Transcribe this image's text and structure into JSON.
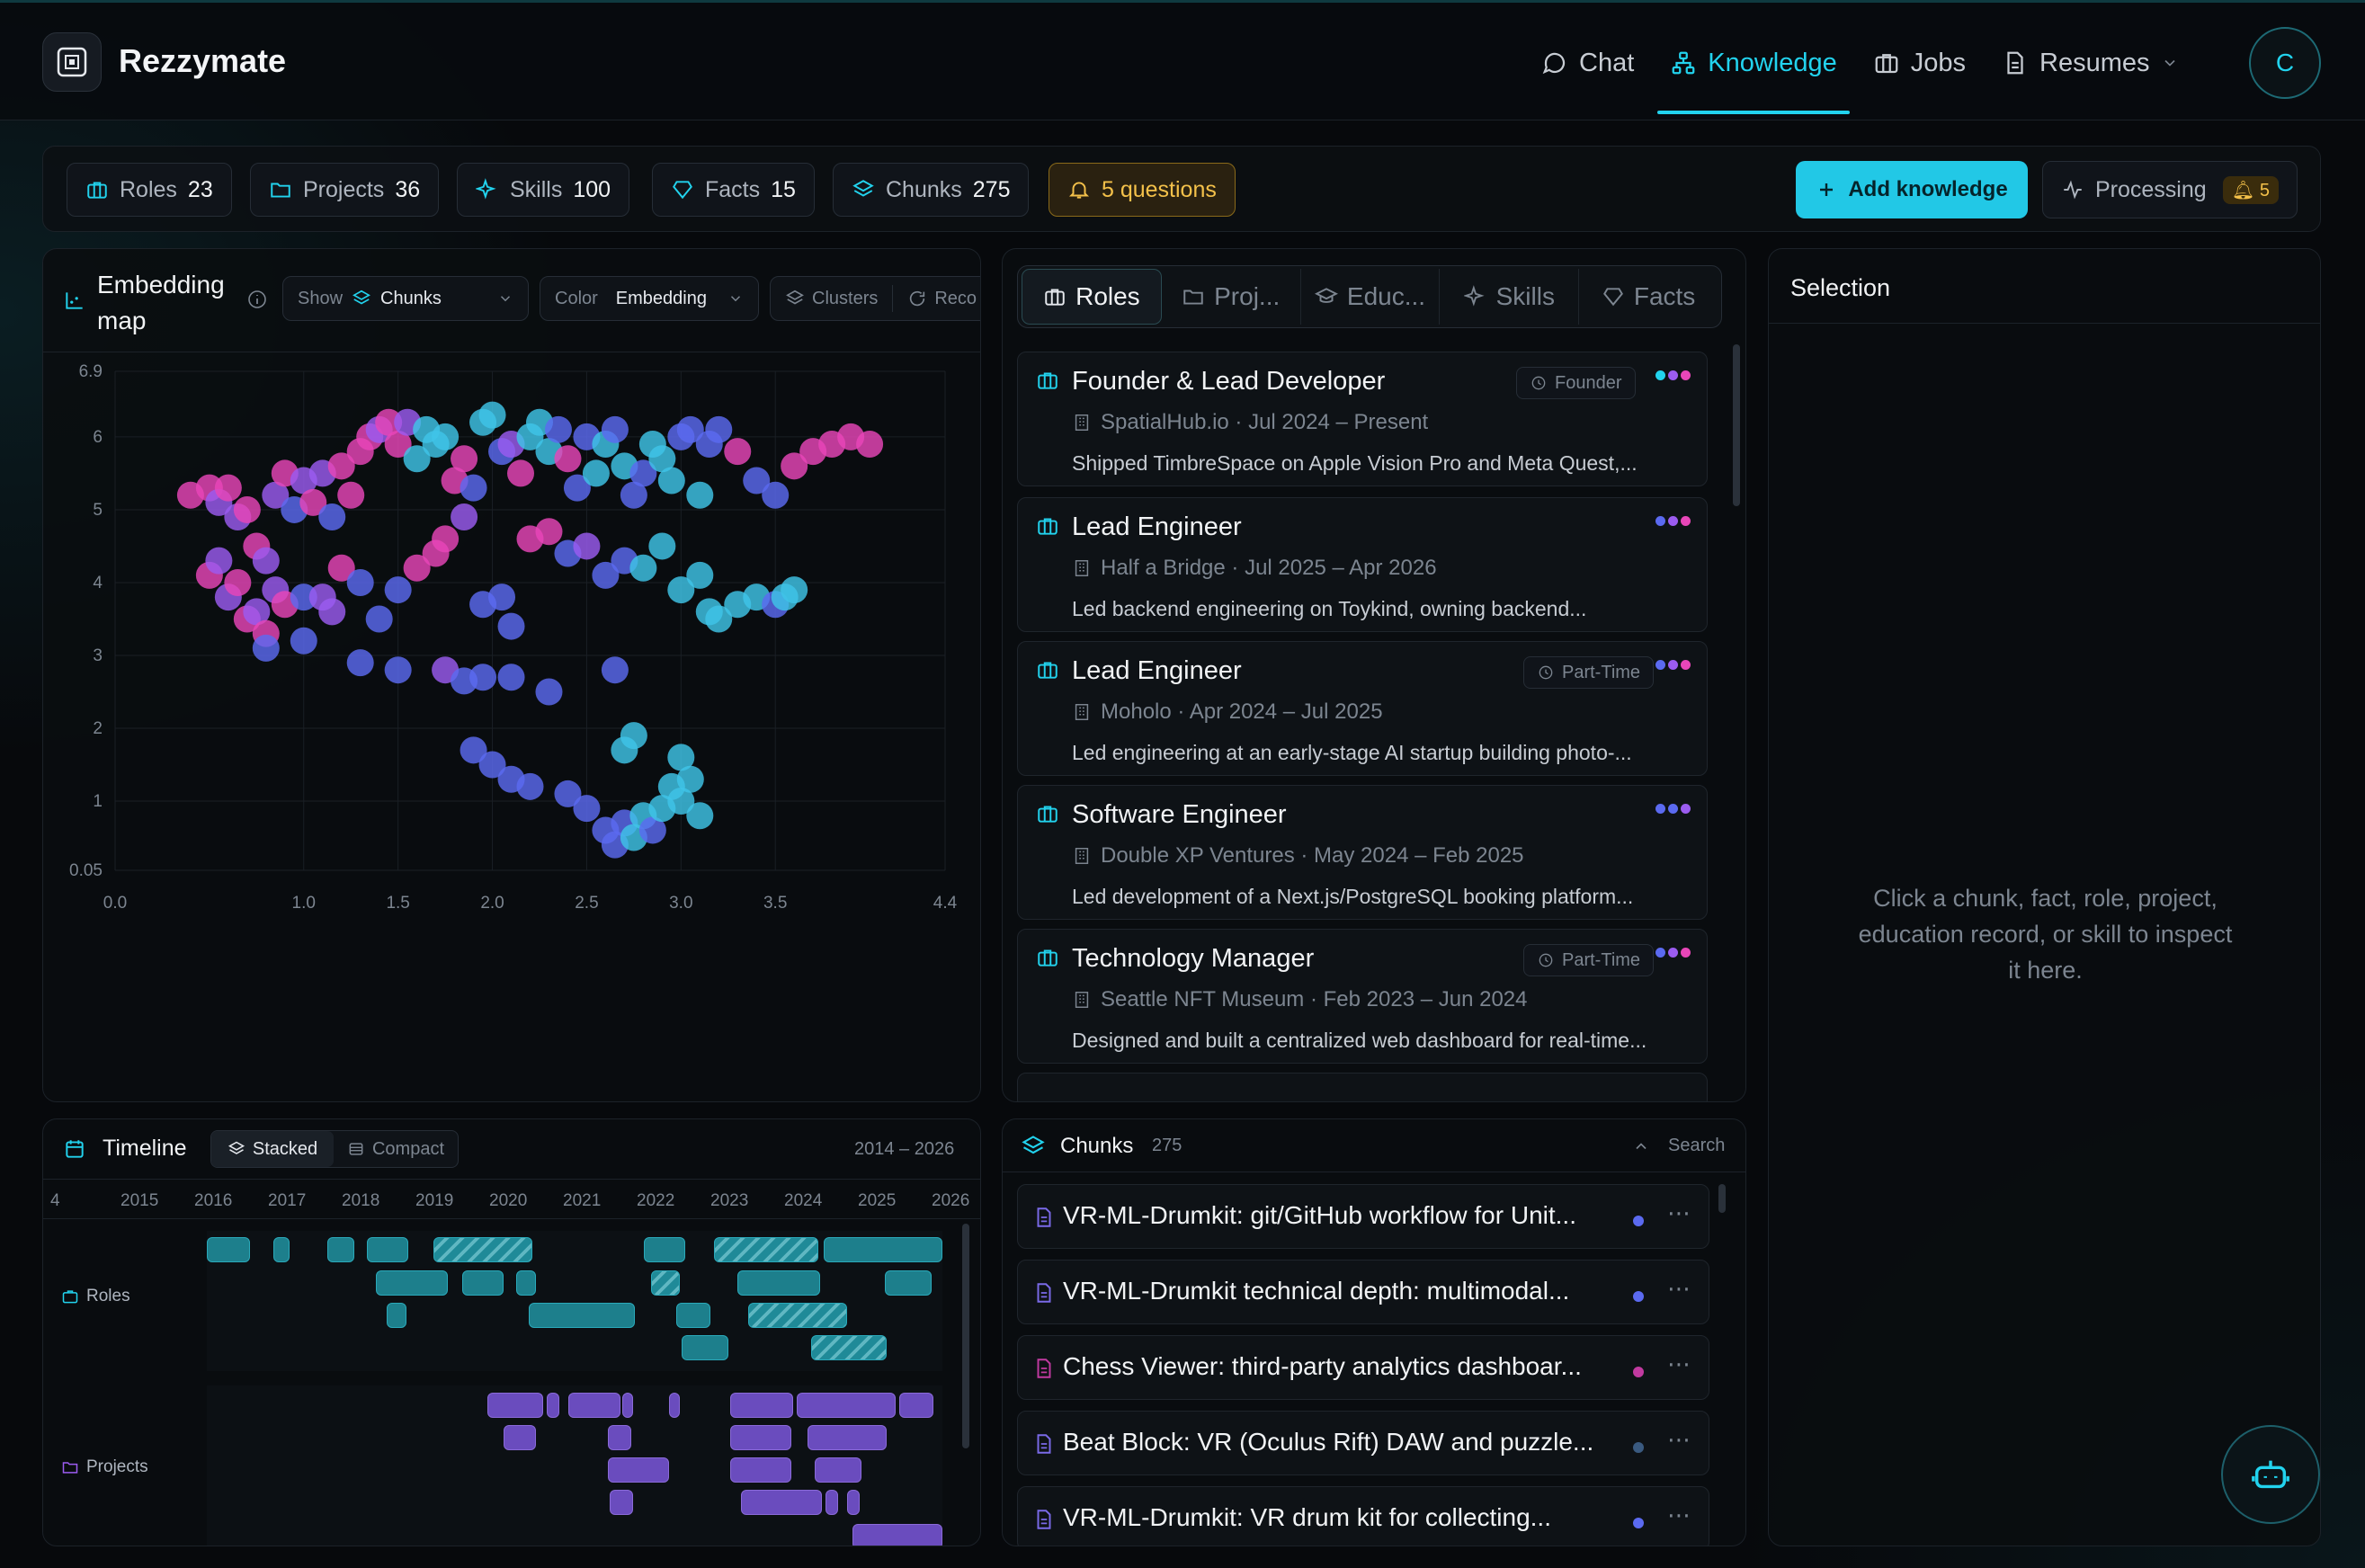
{
  "app": {
    "brand": "Rezzymate",
    "avatar_initial": "C"
  },
  "nav": [
    {
      "label": "Chat",
      "icon": "chat-icon",
      "active": false
    },
    {
      "label": "Knowledge",
      "icon": "knowledge-graph-icon",
      "active": true
    },
    {
      "label": "Jobs",
      "icon": "briefcase-icon",
      "active": false
    },
    {
      "label": "Resumes",
      "icon": "document-icon",
      "active": false
    }
  ],
  "stats": [
    {
      "label": "Roles",
      "count": "23",
      "icon": "briefcase-icon"
    },
    {
      "label": "Projects",
      "count": "36",
      "icon": "folder-icon"
    },
    {
      "label": "Skills",
      "count": "100",
      "icon": "sparkle-icon"
    },
    {
      "label": "Facts",
      "count": "15",
      "icon": "gem-icon"
    },
    {
      "label": "Chunks",
      "count": "275",
      "icon": "layers-icon"
    }
  ],
  "questions": "5 questions",
  "add_knowledge": "Add knowledge",
  "processing": {
    "label": "Processing",
    "count": "5"
  },
  "embedding": {
    "title_line1": "Embedding",
    "title_line2": "map",
    "show_label": "Show",
    "show_value": "Chunks",
    "color_label": "Color",
    "color_value": "Embedding",
    "clusters": "Clusters",
    "recompute": "Reco"
  },
  "chart_data": {
    "type": "scatter",
    "title": "",
    "xlabel": "",
    "ylabel": "",
    "xlim": [
      0.0,
      4.4
    ],
    "ylim": [
      0.05,
      6.9
    ],
    "x_ticks": [
      "0.0",
      "1.0",
      "1.5",
      "2.0",
      "2.5",
      "3.0",
      "3.5",
      "4.4"
    ],
    "y_ticks": [
      "6.9",
      "6",
      "5",
      "4",
      "3",
      "2",
      "1",
      "0.05"
    ],
    "grid": true,
    "legend": "none",
    "colors": {
      "pink": "#e846b8",
      "violet": "#9b5cf0",
      "blue": "#5b6af0",
      "cyan": "#3fc4e8"
    },
    "points": [
      [
        0.4,
        5.2,
        "pink"
      ],
      [
        0.5,
        5.3,
        "pink"
      ],
      [
        0.55,
        5.1,
        "violet"
      ],
      [
        0.6,
        5.3,
        "pink"
      ],
      [
        0.65,
        4.9,
        "violet"
      ],
      [
        0.7,
        5.0,
        "pink"
      ],
      [
        0.75,
        4.5,
        "pink"
      ],
      [
        0.8,
        4.3,
        "violet"
      ],
      [
        0.85,
        5.2,
        "violet"
      ],
      [
        0.9,
        5.5,
        "pink"
      ],
      [
        0.95,
        5.0,
        "blue"
      ],
      [
        1.0,
        5.4,
        "violet"
      ],
      [
        1.05,
        5.1,
        "pink"
      ],
      [
        1.1,
        5.5,
        "violet"
      ],
      [
        1.15,
        4.9,
        "blue"
      ],
      [
        1.2,
        5.6,
        "pink"
      ],
      [
        1.25,
        5.2,
        "pink"
      ],
      [
        1.3,
        5.8,
        "pink"
      ],
      [
        1.35,
        6.0,
        "pink"
      ],
      [
        1.4,
        6.1,
        "violet"
      ],
      [
        1.45,
        6.2,
        "pink"
      ],
      [
        1.5,
        5.9,
        "pink"
      ],
      [
        1.55,
        6.2,
        "violet"
      ],
      [
        1.6,
        5.7,
        "cyan"
      ],
      [
        1.65,
        6.1,
        "cyan"
      ],
      [
        1.7,
        5.9,
        "cyan"
      ],
      [
        1.75,
        6.0,
        "cyan"
      ],
      [
        1.8,
        5.4,
        "pink"
      ],
      [
        1.85,
        5.7,
        "pink"
      ],
      [
        1.9,
        5.3,
        "blue"
      ],
      [
        1.95,
        6.2,
        "cyan"
      ],
      [
        2.0,
        6.3,
        "cyan"
      ],
      [
        2.05,
        5.8,
        "blue"
      ],
      [
        2.1,
        5.9,
        "violet"
      ],
      [
        2.15,
        5.5,
        "pink"
      ],
      [
        2.2,
        6.0,
        "cyan"
      ],
      [
        2.25,
        6.2,
        "cyan"
      ],
      [
        2.3,
        5.8,
        "cyan"
      ],
      [
        2.35,
        6.1,
        "blue"
      ],
      [
        2.4,
        5.7,
        "pink"
      ],
      [
        2.45,
        5.3,
        "blue"
      ],
      [
        2.5,
        6.0,
        "blue"
      ],
      [
        2.55,
        5.5,
        "cyan"
      ],
      [
        2.6,
        5.9,
        "cyan"
      ],
      [
        2.65,
        6.1,
        "blue"
      ],
      [
        2.7,
        5.6,
        "cyan"
      ],
      [
        2.75,
        5.2,
        "blue"
      ],
      [
        2.8,
        5.5,
        "blue"
      ],
      [
        2.85,
        5.9,
        "cyan"
      ],
      [
        2.9,
        5.7,
        "cyan"
      ],
      [
        2.95,
        5.4,
        "cyan"
      ],
      [
        3.0,
        6.0,
        "blue"
      ],
      [
        3.05,
        6.1,
        "blue"
      ],
      [
        3.1,
        5.2,
        "cyan"
      ],
      [
        3.15,
        5.9,
        "blue"
      ],
      [
        3.2,
        6.1,
        "blue"
      ],
      [
        3.3,
        5.8,
        "pink"
      ],
      [
        3.4,
        5.4,
        "blue"
      ],
      [
        3.5,
        5.2,
        "blue"
      ],
      [
        3.6,
        5.6,
        "pink"
      ],
      [
        3.7,
        5.8,
        "pink"
      ],
      [
        3.8,
        5.9,
        "pink"
      ],
      [
        3.9,
        6.0,
        "pink"
      ],
      [
        4.0,
        5.9,
        "pink"
      ],
      [
        0.5,
        4.1,
        "pink"
      ],
      [
        0.55,
        4.3,
        "violet"
      ],
      [
        0.6,
        3.8,
        "violet"
      ],
      [
        0.65,
        4.0,
        "pink"
      ],
      [
        0.7,
        3.5,
        "pink"
      ],
      [
        0.75,
        3.6,
        "violet"
      ],
      [
        0.8,
        3.3,
        "pink"
      ],
      [
        0.85,
        3.9,
        "violet"
      ],
      [
        0.9,
        3.7,
        "pink"
      ],
      [
        1.0,
        3.8,
        "blue"
      ],
      [
        1.1,
        3.8,
        "violet"
      ],
      [
        1.15,
        3.6,
        "violet"
      ],
      [
        1.2,
        4.2,
        "pink"
      ],
      [
        1.3,
        4.0,
        "blue"
      ],
      [
        1.4,
        3.5,
        "blue"
      ],
      [
        1.5,
        3.9,
        "blue"
      ],
      [
        1.6,
        4.2,
        "pink"
      ],
      [
        1.7,
        4.4,
        "pink"
      ],
      [
        1.75,
        4.6,
        "pink"
      ],
      [
        1.85,
        4.9,
        "violet"
      ],
      [
        1.95,
        3.7,
        "blue"
      ],
      [
        2.05,
        3.8,
        "blue"
      ],
      [
        2.1,
        3.4,
        "blue"
      ],
      [
        2.2,
        4.6,
        "pink"
      ],
      [
        2.3,
        4.7,
        "pink"
      ],
      [
        2.4,
        4.4,
        "blue"
      ],
      [
        2.5,
        4.5,
        "violet"
      ],
      [
        2.6,
        4.1,
        "blue"
      ],
      [
        2.7,
        4.3,
        "blue"
      ],
      [
        2.8,
        4.2,
        "cyan"
      ],
      [
        2.9,
        4.5,
        "cyan"
      ],
      [
        3.0,
        3.9,
        "cyan"
      ],
      [
        3.1,
        4.1,
        "cyan"
      ],
      [
        3.15,
        3.6,
        "cyan"
      ],
      [
        3.2,
        3.5,
        "cyan"
      ],
      [
        3.3,
        3.7,
        "cyan"
      ],
      [
        3.4,
        3.8,
        "cyan"
      ],
      [
        3.5,
        3.7,
        "blue"
      ],
      [
        3.55,
        3.8,
        "cyan"
      ],
      [
        3.6,
        3.9,
        "cyan"
      ],
      [
        0.8,
        3.1,
        "blue"
      ],
      [
        1.0,
        3.2,
        "blue"
      ],
      [
        1.3,
        2.9,
        "blue"
      ],
      [
        1.5,
        2.8,
        "blue"
      ],
      [
        1.75,
        2.8,
        "violet"
      ],
      [
        1.85,
        2.65,
        "blue"
      ],
      [
        1.95,
        2.7,
        "blue"
      ],
      [
        2.1,
        2.7,
        "blue"
      ],
      [
        2.3,
        2.5,
        "blue"
      ],
      [
        2.65,
        2.8,
        "blue"
      ],
      [
        1.9,
        1.7,
        "blue"
      ],
      [
        2.0,
        1.5,
        "blue"
      ],
      [
        2.1,
        1.3,
        "blue"
      ],
      [
        2.2,
        1.2,
        "blue"
      ],
      [
        2.4,
        1.1,
        "blue"
      ],
      [
        2.5,
        0.9,
        "blue"
      ],
      [
        2.6,
        0.6,
        "blue"
      ],
      [
        2.65,
        0.4,
        "blue"
      ],
      [
        2.7,
        0.7,
        "blue"
      ],
      [
        2.75,
        0.5,
        "cyan"
      ],
      [
        2.8,
        0.8,
        "cyan"
      ],
      [
        2.85,
        0.6,
        "blue"
      ],
      [
        2.9,
        0.9,
        "cyan"
      ],
      [
        2.95,
        1.2,
        "cyan"
      ],
      [
        3.0,
        1.0,
        "cyan"
      ],
      [
        3.05,
        1.3,
        "cyan"
      ],
      [
        3.1,
        0.8,
        "cyan"
      ],
      [
        3.0,
        1.6,
        "cyan"
      ],
      [
        2.75,
        1.9,
        "cyan"
      ],
      [
        2.7,
        1.7,
        "cyan"
      ]
    ]
  },
  "timeline": {
    "title": "Timeline",
    "stacked": "Stacked",
    "compact": "Compact",
    "range": "2014 – 2026",
    "years": [
      "4",
      "2015",
      "2016",
      "2017",
      "2018",
      "2019",
      "2020",
      "2021",
      "2022",
      "2023",
      "2024",
      "2025",
      "2026"
    ],
    "row_roles": "Roles",
    "row_projects": "Projects"
  },
  "tabs": [
    {
      "label": "Roles",
      "icon": "briefcase-icon",
      "active": true
    },
    {
      "label": "Proj...",
      "icon": "folder-icon",
      "active": false
    },
    {
      "label": "Educ...",
      "icon": "graduation-cap-icon",
      "active": false
    },
    {
      "label": "Skills",
      "icon": "sparkle-icon",
      "active": false
    },
    {
      "label": "Facts",
      "icon": "gem-icon",
      "active": false
    }
  ],
  "roles": [
    {
      "title": "Founder & Lead Developer",
      "org": "SpatialHub.io · Jul 2024 – Present",
      "desc": "Shipped TimbreSpace on Apple Vision Pro and Meta Quest,...",
      "pill": "Founder",
      "pill_icon": "rocket-icon",
      "dots": [
        "#22d3ee",
        "#9b5cf0",
        "#e846b8"
      ]
    },
    {
      "title": "Lead Engineer",
      "org": "Half a Bridge · Jul 2025 – Apr 2026",
      "desc": "Led backend engineering on Toykind, owning backend...",
      "pill": "",
      "pill_icon": "",
      "dots": [
        "#5b6af0",
        "#9b5cf0",
        "#e846b8"
      ]
    },
    {
      "title": "Lead Engineer",
      "org": "Moholo · Apr 2024 – Jul 2025",
      "desc": "Led engineering at an early-stage AI startup building photo-...",
      "pill": "Part-Time",
      "pill_icon": "clock-icon",
      "dots": [
        "#5b6af0",
        "#9b5cf0",
        "#e846b8"
      ]
    },
    {
      "title": "Software Engineer",
      "org": "Double XP Ventures · May 2024 – Feb 2025",
      "desc": "Led development of a Next.js/PostgreSQL booking platform...",
      "pill": "",
      "pill_icon": "",
      "dots": [
        "#5b6af0",
        "#5b6af0",
        "#9b5cf0"
      ]
    },
    {
      "title": "Technology Manager",
      "org": "Seattle NFT Museum · Feb 2023 – Jun 2024",
      "desc": "Designed and built a centralized web dashboard for real-time...",
      "pill": "Part-Time",
      "pill_icon": "clock-icon",
      "dots": [
        "#5b6af0",
        "#9b5cf0",
        "#e846b8"
      ]
    }
  ],
  "chunks_panel": {
    "title": "Chunks",
    "count": "275",
    "search": "Search"
  },
  "chunks": [
    {
      "title": "VR-ML-Drumkit: git/GitHub workflow for Unit...",
      "dot": "#5b6af0"
    },
    {
      "title": "VR-ML-Drumkit technical depth: multimodal...",
      "dot": "#5b6af0"
    },
    {
      "title": "Chess Viewer: third-party analytics dashboar...",
      "dot": "#c13aa0"
    },
    {
      "title": "Beat Block: VR (Oculus Rift) DAW and puzzle...",
      "dot": "#3a5a80"
    },
    {
      "title": "VR-ML-Drumkit: VR drum kit for collecting...",
      "dot": "#5b6af0"
    }
  ],
  "selection": {
    "title": "Selection",
    "empty_line1": "Click a chunk, fact, role, project,",
    "empty_line2": "education record, or skill to inspect",
    "empty_line3": "it here."
  }
}
